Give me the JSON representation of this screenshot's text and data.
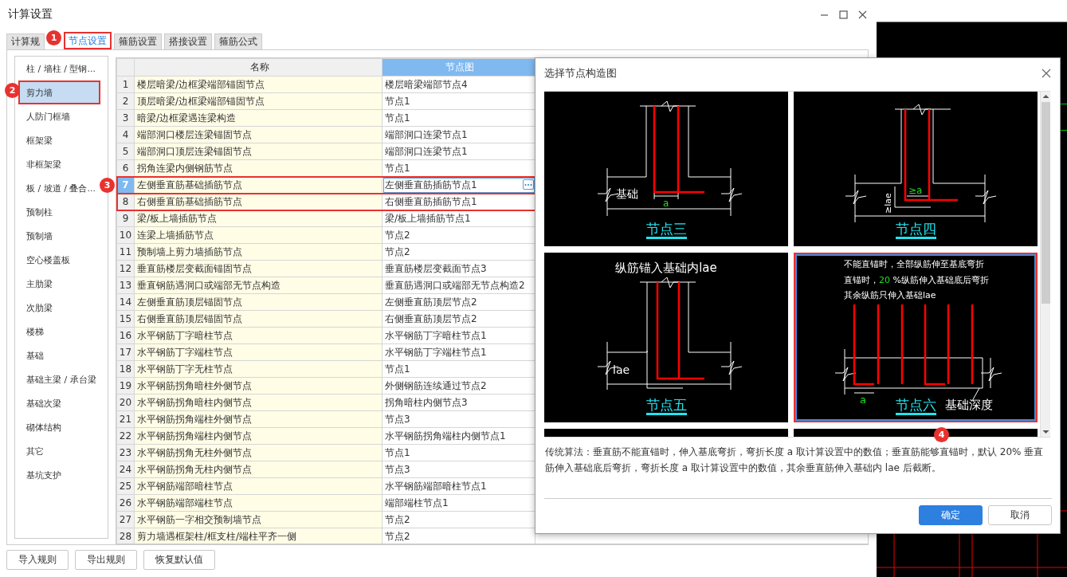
{
  "window": {
    "title": "计算设置"
  },
  "tabs": [
    {
      "label": "计算规",
      "selected": false
    },
    {
      "label": "节点设置",
      "selected": true,
      "highlighted": true
    },
    {
      "label": "箍筋设置",
      "selected": false
    },
    {
      "label": "搭接设置",
      "selected": false
    },
    {
      "label": "箍筋公式",
      "selected": false
    }
  ],
  "sidebar": {
    "items": [
      {
        "label": "柱 / 墙柱 / 型钢...",
        "selected": false
      },
      {
        "label": "剪力墙",
        "selected": true,
        "highlighted": true
      },
      {
        "label": "人防门框墙",
        "selected": false
      },
      {
        "label": "框架梁",
        "selected": false
      },
      {
        "label": "非框架梁",
        "selected": false
      },
      {
        "label": "板 / 坡道 / 叠合...",
        "selected": false
      },
      {
        "label": "预制柱",
        "selected": false
      },
      {
        "label": "预制墙",
        "selected": false
      },
      {
        "label": "空心楼盖板",
        "selected": false
      },
      {
        "label": "主肋梁",
        "selected": false
      },
      {
        "label": "次肋梁",
        "selected": false
      },
      {
        "label": "楼梯",
        "selected": false
      },
      {
        "label": "基础",
        "selected": false
      },
      {
        "label": "基础主梁 / 承台梁",
        "selected": false
      },
      {
        "label": "基础次梁",
        "selected": false
      },
      {
        "label": "砌体结构",
        "selected": false
      },
      {
        "label": "其它",
        "selected": false
      },
      {
        "label": "基坑支护",
        "selected": false
      }
    ]
  },
  "table": {
    "columns": [
      {
        "label": "名称",
        "selected": false
      },
      {
        "label": "节点图",
        "selected": true
      }
    ],
    "rows": [
      {
        "number": "1",
        "name": "楼层暗梁/边框梁端部锚固节点",
        "node": "楼层暗梁端部节点4",
        "selected": false,
        "editing": false
      },
      {
        "number": "2",
        "name": "顶层暗梁/边框梁端部锚固节点",
        "node": "节点1",
        "selected": false,
        "editing": false
      },
      {
        "number": "3",
        "name": "暗梁/边框梁遇连梁构造",
        "node": "节点1",
        "selected": false,
        "editing": false
      },
      {
        "number": "4",
        "name": "端部洞口楼层连梁锚固节点",
        "node": "端部洞口连梁节点1",
        "selected": false,
        "editing": false
      },
      {
        "number": "5",
        "name": "端部洞口顶层连梁锚固节点",
        "node": "端部洞口连梁节点1",
        "selected": false,
        "editing": false
      },
      {
        "number": "6",
        "name": "拐角连梁内侧钢筋节点",
        "node": "节点1",
        "selected": false,
        "editing": false
      },
      {
        "number": "7",
        "name": "左侧垂直筋基础插筋节点",
        "node": "左侧垂直筋插筋节点1",
        "selected": true,
        "editing": true,
        "highlighted": true
      },
      {
        "number": "8",
        "name": "右侧垂直筋基础插筋节点",
        "node": "右侧垂直筋插筋节点1",
        "selected": false,
        "editing": false,
        "highlighted": true
      },
      {
        "number": "9",
        "name": "梁/板上墙插筋节点",
        "node": "梁/板上墙插筋节点1",
        "selected": false,
        "editing": false
      },
      {
        "number": "10",
        "name": "连梁上墙插筋节点",
        "node": "节点2",
        "selected": false,
        "editing": false
      },
      {
        "number": "11",
        "name": "预制墙上剪力墙插筋节点",
        "node": "节点2",
        "selected": false,
        "editing": false
      },
      {
        "number": "12",
        "name": "垂直筋楼层变截面锚固节点",
        "node": "垂直筋楼层变截面节点3",
        "selected": false,
        "editing": false
      },
      {
        "number": "13",
        "name": "垂直钢筋遇洞口或端部无节点构造",
        "node": "垂直筋遇洞口或端部无节点构造2",
        "selected": false,
        "editing": false
      },
      {
        "number": "14",
        "name": "左侧垂直筋顶层锚固节点",
        "node": "左侧垂直筋顶层节点2",
        "selected": false,
        "editing": false
      },
      {
        "number": "15",
        "name": "右侧垂直筋顶层锚固节点",
        "node": "右侧垂直筋顶层节点2",
        "selected": false,
        "editing": false
      },
      {
        "number": "16",
        "name": "水平钢筋丁字暗柱节点",
        "node": "水平钢筋丁字暗柱节点1",
        "selected": false,
        "editing": false
      },
      {
        "number": "17",
        "name": "水平钢筋丁字端柱节点",
        "node": "水平钢筋丁字端柱节点1",
        "selected": false,
        "editing": false
      },
      {
        "number": "18",
        "name": "水平钢筋丁字无柱节点",
        "node": "节点1",
        "selected": false,
        "editing": false
      },
      {
        "number": "19",
        "name": "水平钢筋拐角暗柱外侧节点",
        "node": "外侧钢筋连续通过节点2",
        "selected": false,
        "editing": false
      },
      {
        "number": "20",
        "name": "水平钢筋拐角暗柱内侧节点",
        "node": "拐角暗柱内侧节点3",
        "selected": false,
        "editing": false
      },
      {
        "number": "21",
        "name": "水平钢筋拐角端柱外侧节点",
        "node": "节点3",
        "selected": false,
        "editing": false
      },
      {
        "number": "22",
        "name": "水平钢筋拐角端柱内侧节点",
        "node": "水平钢筋拐角端柱内侧节点1",
        "selected": false,
        "editing": false
      },
      {
        "number": "23",
        "name": "水平钢筋拐角无柱外侧节点",
        "node": "节点1",
        "selected": false,
        "editing": false
      },
      {
        "number": "24",
        "name": "水平钢筋拐角无柱内侧节点",
        "node": "节点3",
        "selected": false,
        "editing": false
      },
      {
        "number": "25",
        "name": "水平钢筋端部暗柱节点",
        "node": "水平钢筋端部暗柱节点1",
        "selected": false,
        "editing": false
      },
      {
        "number": "26",
        "name": "水平钢筋端部端柱节点",
        "node": "端部端柱节点1",
        "selected": false,
        "editing": false
      },
      {
        "number": "27",
        "name": "水平钢筋一字相交预制墙节点",
        "node": "节点2",
        "selected": false,
        "editing": false
      },
      {
        "number": "28",
        "name": "剪力墙遇框架柱/框支柱/端柱平齐一侧",
        "node": "节点2",
        "selected": false,
        "editing": false
      }
    ]
  },
  "buttons": [
    "导入规则",
    "导出规则",
    "恢复默认值"
  ],
  "dialog": {
    "title": "选择节点构造图",
    "cards": [
      {
        "kind": "bend",
        "labels": [
          {
            "text": "基础",
            "highlight": false
          },
          {
            "text": "a",
            "highlight": true
          }
        ],
        "link": "节点三",
        "selected": false
      },
      {
        "kind": "bend-lae",
        "labels": [
          {
            "text": "≥a",
            "highlight": true
          },
          {
            "text": "≥lae",
            "highlight": false
          }
        ],
        "link": "节点四",
        "selected": false
      },
      {
        "kind": "straight",
        "caption": "纵筋锚入基础内lae",
        "labels": [
          {
            "text": "lae",
            "highlight": false
          }
        ],
        "link": "节点五",
        "selected": false
      },
      {
        "kind": "partial",
        "notes": [
          [
            {
              "text": "不能直锚时，全部纵筋伸至基底弯折",
              "highlight": false
            }
          ],
          [
            {
              "text": "直锚时，",
              "highlight": false
            },
            {
              "text": "20",
              "highlight": true
            },
            {
              "text": " %纵筋伸入基础底后弯折",
              "highlight": false
            }
          ],
          [
            {
              "text": "其余纵筋只伸入基础lae",
              "highlight": false
            }
          ]
        ],
        "labels": [
          {
            "text": "a",
            "highlight": true
          },
          {
            "text": "基础深度",
            "highlight": false
          }
        ],
        "link": "节点六",
        "selected": true,
        "highlighted": true
      }
    ],
    "description": "传统算法：垂直筋不能直锚时，伸入基底弯折，弯折长度 a 取计算设置中的数值；垂直筋能够直锚时，默认 20% 垂直筋伸入基础底后弯折，弯折长度 a 取计算设置中的数值，其余垂直筋伸入基础内 lae 后截断。",
    "buttons": [
      {
        "label": "确定",
        "primary": true
      },
      {
        "label": "取消",
        "primary": false
      }
    ]
  },
  "annotations": [
    {
      "number": "1"
    },
    {
      "number": "2"
    },
    {
      "number": "3"
    },
    {
      "number": "4"
    }
  ]
}
